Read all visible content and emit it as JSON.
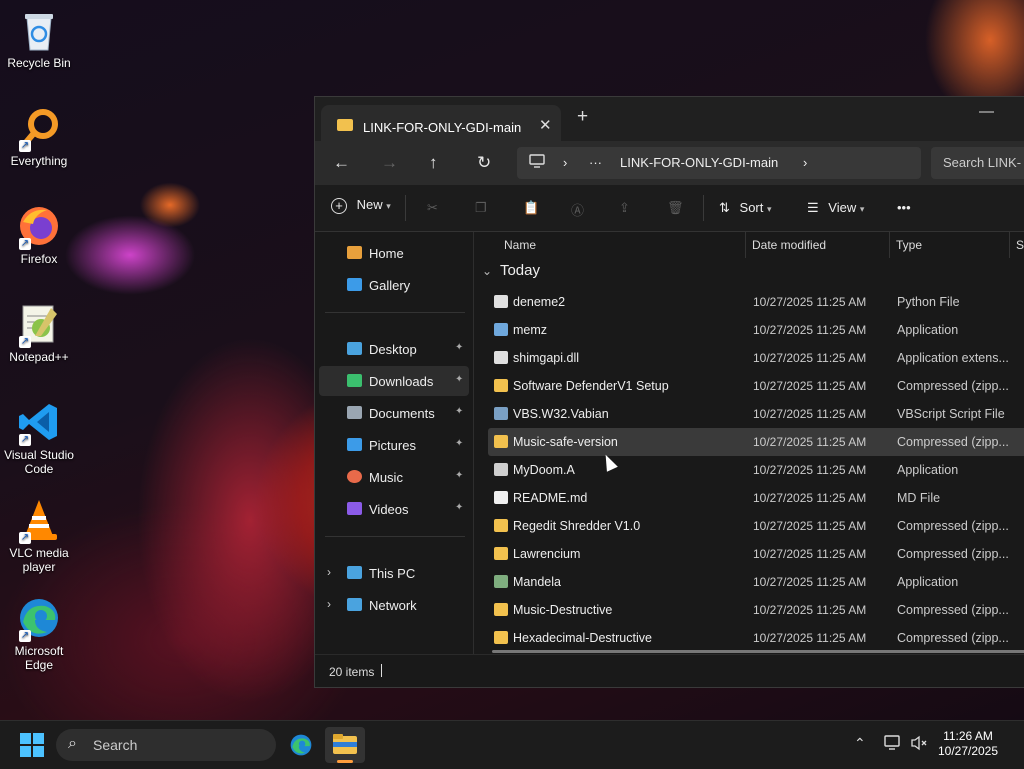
{
  "desktop": {
    "icons": [
      {
        "label": "Recycle Bin",
        "icon": "recycle-bin-icon"
      },
      {
        "label": "Everything",
        "icon": "everything-search-icon"
      },
      {
        "label": "Firefox",
        "icon": "firefox-icon"
      },
      {
        "label": "Notepad++",
        "icon": "notepad-plus-plus-icon"
      },
      {
        "label": "Visual Studio Code",
        "icon": "vscode-icon"
      },
      {
        "label": "VLC media player",
        "icon": "vlc-icon"
      },
      {
        "label": "Microsoft Edge",
        "icon": "edge-icon"
      }
    ]
  },
  "explorer": {
    "tab_title": "LINK-FOR-ONLY-GDI-main",
    "tab_close": "✕",
    "new_tab": "+",
    "minimize": "—",
    "nav": {
      "back": "←",
      "forward": "→",
      "up": "↑",
      "refresh": "↻"
    },
    "breadcrumb": {
      "more": "···",
      "current": "LINK-FOR-ONLY-GDI-main",
      "sep": "›",
      "end_chevron": "›"
    },
    "search_placeholder": "Search LINK-",
    "toolbar": {
      "new_label": "New",
      "sort_label": "Sort",
      "view_label": "View",
      "more": "•••"
    },
    "sidebar": {
      "top": [
        {
          "label": "Home",
          "color": "#e8a03c"
        },
        {
          "label": "Gallery",
          "color": "#3c9be8"
        }
      ],
      "pinned": [
        {
          "label": "Desktop",
          "color": "#4aa3df",
          "selected": false
        },
        {
          "label": "Downloads",
          "color": "#3bbf6e",
          "selected": true
        },
        {
          "label": "Documents",
          "color": "#9aa6b2",
          "selected": false
        },
        {
          "label": "Pictures",
          "color": "#3c9be8",
          "selected": false
        },
        {
          "label": "Music",
          "color": "#e86a4a",
          "selected": false
        },
        {
          "label": "Videos",
          "color": "#8b5be8",
          "selected": false
        }
      ],
      "pin_glyph": "📌",
      "bottom": [
        {
          "label": "This PC",
          "color": "#4aa3df"
        },
        {
          "label": "Network",
          "color": "#4aa3df"
        }
      ],
      "expand_glyph": "›"
    },
    "columns": {
      "name": "Name",
      "date": "Date modified",
      "type": "Type",
      "size": "Si"
    },
    "group_label": "Today",
    "group_chevron": "⌄",
    "files": [
      {
        "name": "deneme2",
        "date": "10/27/2025 11:25 AM",
        "type": "Python File",
        "icon": "python-file-icon",
        "color": "#e0e0e0"
      },
      {
        "name": "memz",
        "date": "10/27/2025 11:25 AM",
        "type": "Application",
        "icon": "application-icon",
        "color": "#6fa8dc"
      },
      {
        "name": "shimgapi.dll",
        "date": "10/27/2025 11:25 AM",
        "type": "Application extens...",
        "icon": "dll-file-icon",
        "color": "#e0e0e0"
      },
      {
        "name": "Software DefenderV1 Setup",
        "date": "10/27/2025 11:25 AM",
        "type": "Compressed (zipp...",
        "icon": "zip-folder-icon",
        "color": "#f2c14e"
      },
      {
        "name": "VBS.W32.Vabian",
        "date": "10/27/2025 11:25 AM",
        "type": "VBScript Script File",
        "icon": "vbscript-file-icon",
        "color": "#7aa0c4"
      },
      {
        "name": "Music-safe-version",
        "date": "10/27/2025 11:25 AM",
        "type": "Compressed (zipp...",
        "icon": "zip-folder-icon",
        "color": "#f2c14e",
        "selected": true
      },
      {
        "name": "MyDoom.A",
        "date": "10/27/2025 11:25 AM",
        "type": "Application",
        "icon": "application-icon",
        "color": "#cfcfcf"
      },
      {
        "name": "README.md",
        "date": "10/27/2025 11:25 AM",
        "type": "MD File",
        "icon": "text-file-icon",
        "color": "#f0f0f0"
      },
      {
        "name": "Regedit Shredder V1.0",
        "date": "10/27/2025 11:25 AM",
        "type": "Compressed (zipp...",
        "icon": "zip-folder-icon",
        "color": "#f2c14e"
      },
      {
        "name": "Lawrencium",
        "date": "10/27/2025 11:25 AM",
        "type": "Compressed (zipp...",
        "icon": "zip-folder-icon",
        "color": "#f2c14e"
      },
      {
        "name": "Mandela",
        "date": "10/27/2025 11:25 AM",
        "type": "Application",
        "icon": "application-icon",
        "color": "#7fae7f"
      },
      {
        "name": "Music-Destructive",
        "date": "10/27/2025 11:25 AM",
        "type": "Compressed (zipp...",
        "icon": "zip-folder-icon",
        "color": "#f2c14e"
      },
      {
        "name": "Hexadecimal-Destructive",
        "date": "10/27/2025 11:25 AM",
        "type": "Compressed (zipp...",
        "icon": "zip-folder-icon",
        "color": "#f2c14e"
      }
    ],
    "status": {
      "item_count": "20 items"
    }
  },
  "taskbar": {
    "search_label": "Search",
    "search_glyph": "⌕",
    "tray_chevron": "⌃",
    "clock_time": "11:26 AM",
    "clock_date": "10/27/2025",
    "accent": "#4cc2ff"
  }
}
